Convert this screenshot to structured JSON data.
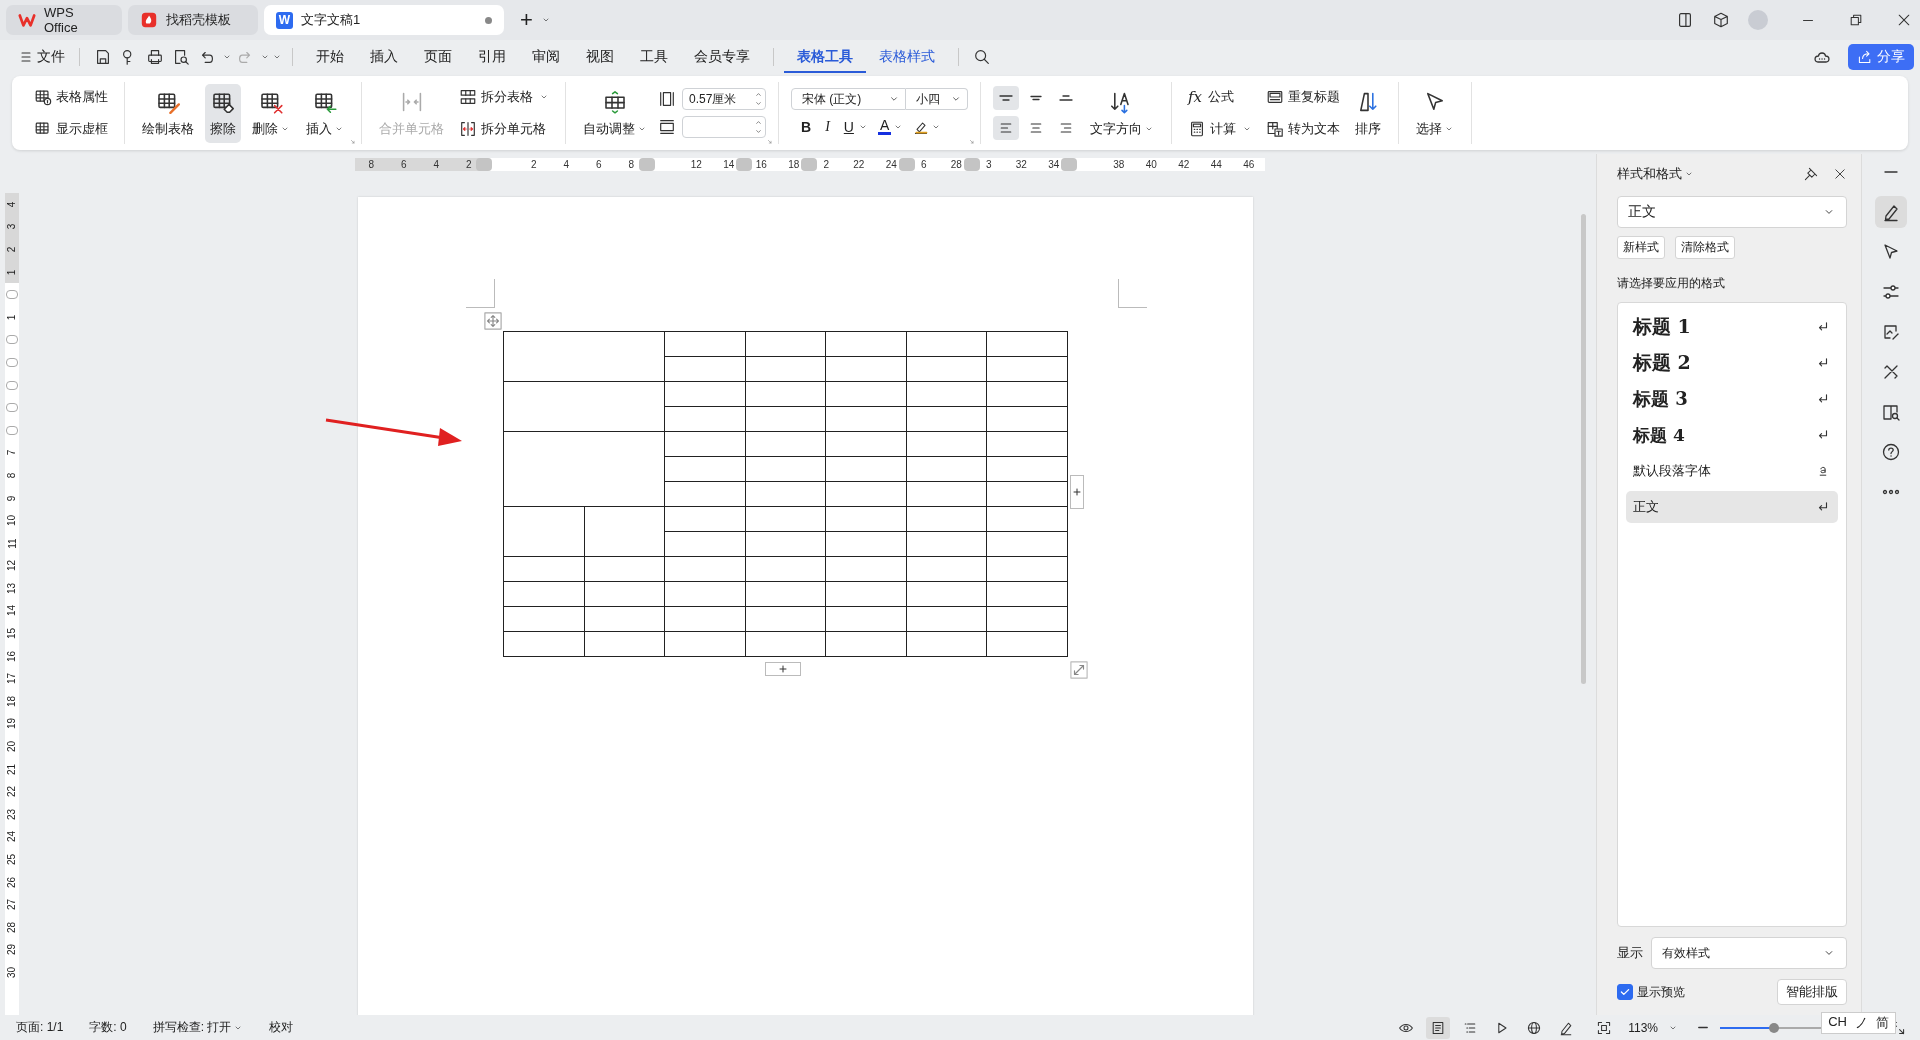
{
  "tabs": [
    {
      "label": "WPS Office",
      "kind": "home",
      "selected": false
    },
    {
      "label": "找稻壳模板",
      "kind": "template",
      "selected": false
    },
    {
      "label": "文字文稿1",
      "kind": "doc",
      "logo_text": "W",
      "selected": true,
      "unsaved": true
    }
  ],
  "new_tab": "+",
  "menu": {
    "file": "文件",
    "tabs": [
      {
        "label": "开始",
        "selected": false
      },
      {
        "label": "插入",
        "selected": false
      },
      {
        "label": "页面",
        "selected": false
      },
      {
        "label": "引用",
        "selected": false
      },
      {
        "label": "审阅",
        "selected": false
      },
      {
        "label": "视图",
        "selected": false
      },
      {
        "label": "工具",
        "selected": false
      },
      {
        "label": "会员专享",
        "selected": false
      },
      {
        "label": "表格工具",
        "selected": true,
        "contextual": true
      },
      {
        "label": "表格样式",
        "selected": false,
        "contextual": true
      }
    ],
    "share": "分享"
  },
  "ribbon": {
    "groups": [
      {
        "columns": [
          {
            "kind": "stack",
            "items": [
              {
                "kind": "button",
                "label": "表格属性"
              },
              {
                "kind": "button",
                "label": "显示虚框"
              }
            ]
          }
        ]
      },
      {
        "launcher": true,
        "columns": [
          {
            "kind": "large",
            "label": "绘制表格",
            "pressed": false
          },
          {
            "kind": "large",
            "label": "擦除",
            "pressed": true
          },
          {
            "kind": "large",
            "label": "删除",
            "pressed": false,
            "menu": true
          },
          {
            "kind": "large",
            "label": "插入",
            "pressed": false,
            "menu": true
          }
        ]
      },
      {
        "columns": [
          {
            "kind": "large",
            "label": "合并单元格",
            "pressed": false,
            "disabled": true
          },
          {
            "kind": "stack",
            "items": [
              {
                "kind": "button",
                "label": "拆分表格",
                "menu": true
              },
              {
                "kind": "button",
                "label": "拆分单元格"
              }
            ]
          }
        ]
      },
      {
        "launcher": true,
        "columns": [
          {
            "kind": "large",
            "label": "自动调整",
            "pressed": false,
            "menu": true
          },
          {
            "kind": "stack",
            "items": [
              {
                "kind": "field",
                "value": "0.57厘米"
              },
              {
                "kind": "field"
              }
            ]
          }
        ]
      },
      {
        "launcher": true,
        "columns": [
          {
            "kind": "stack",
            "items": [
              {
                "kind": "combos",
                "combos": [
                  {
                    "value": "宋体 (正文)"
                  },
                  {
                    "value": "小四"
                  }
                ]
              },
              {
                "kind": "format",
                "buttons": [
                  {
                    "kind": "bold",
                    "text": "B"
                  },
                  {
                    "kind": "italic",
                    "text": "I"
                  },
                  {
                    "kind": "underline",
                    "text": "U",
                    "menu": true
                  },
                  {
                    "kind": "color",
                    "text": "A",
                    "menu": true
                  },
                  {
                    "kind": "highlight",
                    "menu": true
                  }
                ]
              }
            ]
          }
        ]
      },
      {
        "columns": [
          {
            "kind": "stack",
            "items": [
              {
                "kind": "aligns",
                "buttons": [
                  {
                    "selected": true
                  },
                  {
                    "selected": false
                  },
                  {
                    "selected": false
                  }
                ]
              },
              {
                "kind": "aligns",
                "buttons": [
                  {
                    "selected": true
                  },
                  {
                    "selected": false
                  },
                  {
                    "selected": false
                  }
                ]
              }
            ]
          },
          {
            "kind": "large",
            "label": "文字方向",
            "pressed": false,
            "menu": true
          }
        ]
      },
      {
        "columns": [
          {
            "kind": "stack",
            "items": [
              {
                "kind": "button",
                "label": "公式",
                "glyph": "fx"
              },
              {
                "kind": "button",
                "label": "计算",
                "menu": true
              }
            ]
          },
          {
            "kind": "stack",
            "items": [
              {
                "kind": "button",
                "label": "重复标题"
              },
              {
                "kind": "button",
                "label": "转为文本"
              }
            ]
          },
          {
            "kind": "large",
            "label": "排序",
            "pressed": false
          }
        ]
      },
      {
        "columns": [
          {
            "kind": "large",
            "label": "选择",
            "pressed": false,
            "menu": true
          }
        ]
      }
    ]
  },
  "hruler": [
    {
      "text": "8"
    },
    {
      "text": "6"
    },
    {
      "text": "4"
    },
    {
      "text": "2"
    },
    {
      "grip": true
    },
    {
      "text": "2"
    },
    {
      "text": "4"
    },
    {
      "text": "6"
    },
    {
      "text": "8"
    },
    {
      "grip": true
    },
    {
      "text": "12"
    },
    {
      "text": "14"
    },
    {
      "text": "16",
      "grip": true
    },
    {
      "text": "18"
    },
    {
      "text": "2",
      "grip": true
    },
    {
      "text": "22"
    },
    {
      "text": "24"
    },
    {
      "text": "6",
      "grip": true
    },
    {
      "text": "28"
    },
    {
      "text": "3",
      "grip": true
    },
    {
      "text": "32"
    },
    {
      "text": "34"
    },
    {
      "grip": true
    },
    {
      "text": "38"
    },
    {
      "text": "40"
    },
    {
      "text": "42"
    },
    {
      "text": "44"
    },
    {
      "text": "46"
    }
  ],
  "vruler": [
    {
      "text": "4"
    },
    {
      "text": "3"
    },
    {
      "text": "2"
    },
    {
      "text": "1"
    },
    {
      "grip": true
    },
    {
      "text": "1"
    },
    {
      "grip": true
    },
    {
      "grip": true
    },
    {
      "grip": true
    },
    {
      "grip": true
    },
    {
      "grip": true
    },
    {
      "text": "7"
    },
    {
      "text": "8"
    },
    {
      "text": "9"
    },
    {
      "text": "10"
    },
    {
      "text": "11"
    },
    {
      "text": "12"
    },
    {
      "text": "13"
    },
    {
      "text": "14"
    },
    {
      "text": "15"
    },
    {
      "text": "16"
    },
    {
      "text": "17"
    },
    {
      "text": "18"
    },
    {
      "text": "19"
    },
    {
      "text": "20"
    },
    {
      "text": "21"
    },
    {
      "text": "22"
    },
    {
      "text": "23"
    },
    {
      "text": "24"
    },
    {
      "text": "25"
    },
    {
      "text": "26"
    },
    {
      "text": "27"
    },
    {
      "text": "28"
    },
    {
      "text": "29"
    },
    {
      "text": "30"
    }
  ],
  "table": {
    "rows": [
      [
        {
          "kind": "double"
        },
        {},
        {},
        {},
        {},
        {}
      ],
      [
        {},
        {},
        {},
        {},
        {}
      ],
      [
        {
          "kind": "double"
        },
        {},
        {},
        {},
        {},
        {}
      ],
      [
        {},
        {},
        {},
        {},
        {}
      ],
      [
        {
          "kind": "triple"
        },
        {},
        {},
        {},
        {},
        {}
      ],
      [
        {},
        {},
        {},
        {},
        {}
      ],
      [
        {},
        {},
        {},
        {},
        {}
      ],
      [
        {
          "kind": "tall"
        },
        {
          "kind": "tall"
        },
        {},
        {},
        {},
        {},
        {}
      ],
      [
        {},
        {},
        {},
        {},
        {}
      ],
      [
        {},
        {},
        {},
        {},
        {},
        {},
        {}
      ],
      [
        {},
        {},
        {},
        {},
        {},
        {},
        {}
      ],
      [
        {},
        {},
        {},
        {},
        {},
        {},
        {}
      ],
      [
        {},
        {},
        {},
        {},
        {},
        {},
        {}
      ]
    ]
  },
  "styles_panel": {
    "title": "样式和格式",
    "current": "正文",
    "buttons": [
      "新样式",
      "清除格式"
    ],
    "prompt": "请选择要应用的格式",
    "styles": [
      {
        "label": "标题 1",
        "kind": "h1",
        "selected": false
      },
      {
        "label": "标题 2",
        "kind": "h2",
        "selected": false
      },
      {
        "label": "标题 3",
        "kind": "h3",
        "selected": false
      },
      {
        "label": "标题 4",
        "kind": "h4",
        "selected": false
      },
      {
        "label": "默认段落字体",
        "kind": "char",
        "selected": false
      },
      {
        "label": "正文",
        "kind": "para",
        "selected": true
      }
    ],
    "show_label": "显示",
    "show_value": "有效样式",
    "preview": {
      "label": "显示预览",
      "checked": true
    },
    "smart_button": "智能排版"
  },
  "tool_bar": [
    {
      "selected": false
    },
    {
      "selected": true
    },
    {
      "selected": false
    },
    {
      "selected": false
    },
    {
      "selected": false
    },
    {
      "selected": false
    },
    {
      "selected": false
    },
    {
      "selected": false
    },
    {
      "selected": false
    }
  ],
  "status_bar": {
    "items": [
      "页面: 1/1",
      "字数: 0",
      "拼写检查: 打开",
      "校对"
    ],
    "spell_menu": true,
    "views": [
      {
        "selected": false
      },
      {
        "selected": true
      },
      {
        "selected": false
      },
      {
        "selected": false
      },
      {
        "selected": false
      },
      {
        "selected": false
      }
    ],
    "zoom": "113%",
    "zoom_level": {
      "level": 0.45
    }
  },
  "ime": [
    "CH",
    "ノ",
    "简"
  ]
}
